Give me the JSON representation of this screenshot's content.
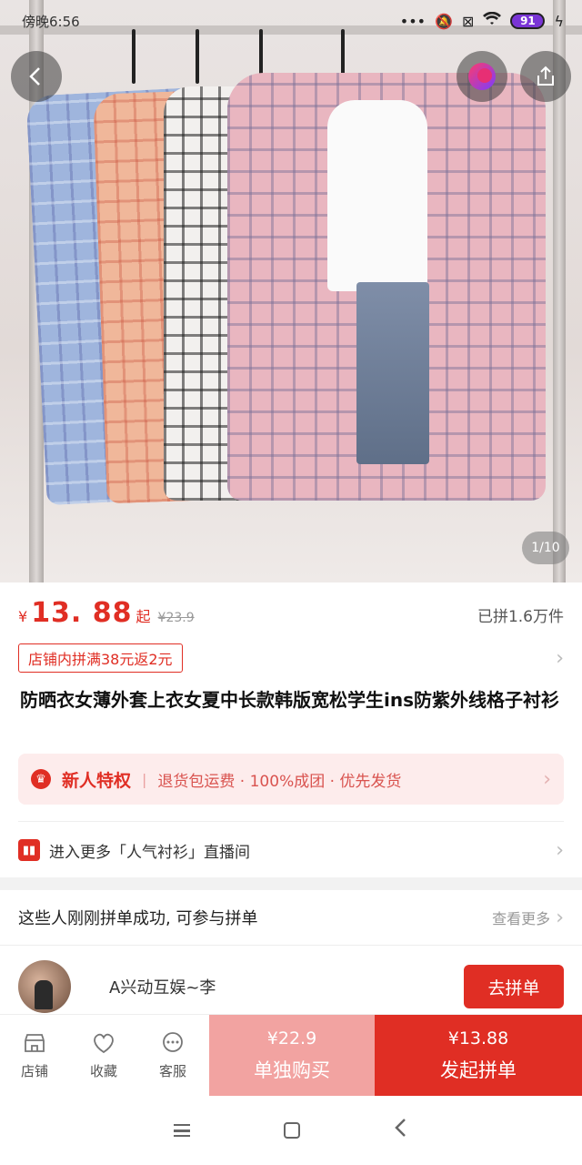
{
  "status_bar": {
    "time": "傍晚6:56",
    "battery": "91"
  },
  "hero": {
    "image_counter": "1/10"
  },
  "price": {
    "currency": "¥",
    "amount": "13. 88",
    "suffix": "起",
    "original": "¥23.9",
    "sold": "已拼1.6万件"
  },
  "coupon": {
    "label": "店铺内拼满38元返2元"
  },
  "product": {
    "title": "防晒衣女薄外套上衣女夏中长款韩版宽松学生ins防紫外线格子衬衫"
  },
  "perk": {
    "title": "新人特权",
    "text": "退货包运费 · 100%成团 · 优先发货"
  },
  "live": {
    "text": "进入更多「人气衬衫」直播间"
  },
  "group": {
    "heading": "这些人刚刚拼单成功, 可参与拼单",
    "more": "查看更多",
    "user_name": "A兴动互娱~李",
    "join_button": "去拼单"
  },
  "bottom_bar": {
    "store": "店铺",
    "favorite": "收藏",
    "service": "客服",
    "single_price": "¥22.9",
    "single_label": "单独购买",
    "group_price": "¥13.88",
    "group_label": "发起拼单"
  },
  "colors": {
    "accent": "#e02e24",
    "single_buy_bg": "#f2a3a1",
    "perk_bg": "#fdecec"
  },
  "icons": {
    "back": "chevron-left-icon",
    "share": "share-icon",
    "brand": "brand-orb-icon",
    "store": "store-icon",
    "favorite": "heart-icon",
    "service": "chat-icon",
    "crown": "crown-icon",
    "live": "live-tv-icon"
  }
}
